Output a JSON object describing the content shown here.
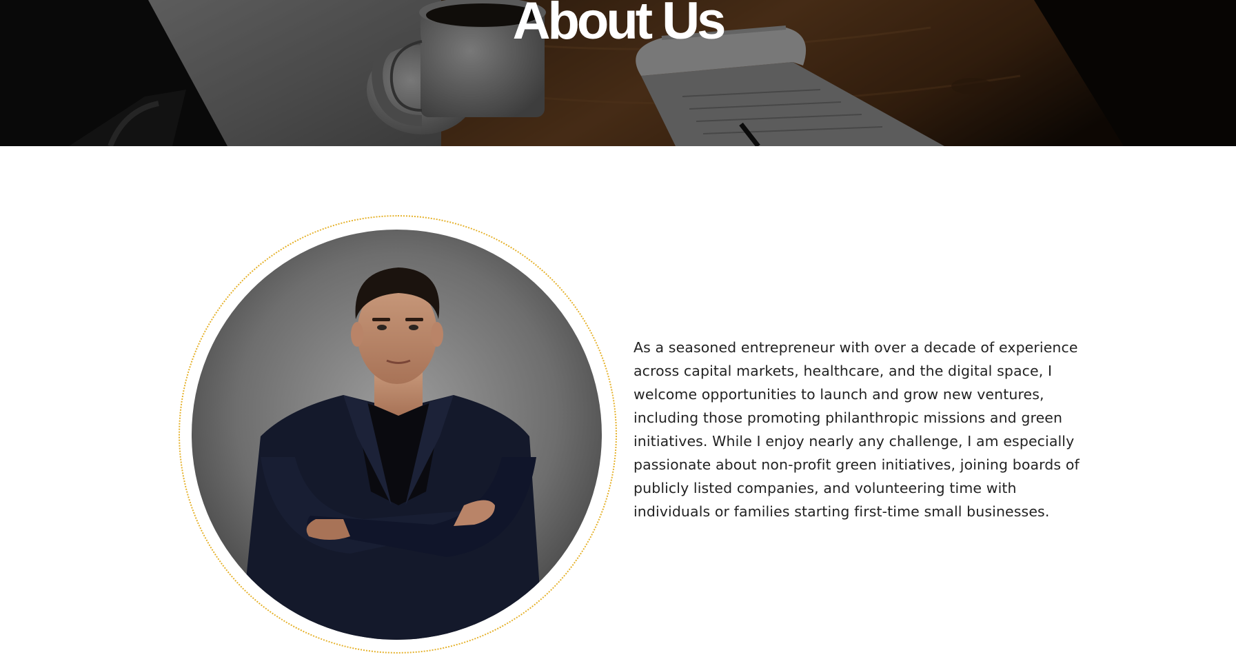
{
  "hero": {
    "title": "About Us"
  },
  "about": {
    "bio": "As a seasoned entrepreneur with over a decade of experience across capital markets, healthcare, and the digital space, I welcome opportunities to launch and grow new ventures, including those promoting philanthropic missions and green initiatives. While I enjoy nearly any challenge, I am especially passionate about non-profit green initiatives, joining boards of publicly listed companies, and volunteering time with individuals or families starting first-time small businesses.",
    "accent_color": "#e5b12a"
  }
}
